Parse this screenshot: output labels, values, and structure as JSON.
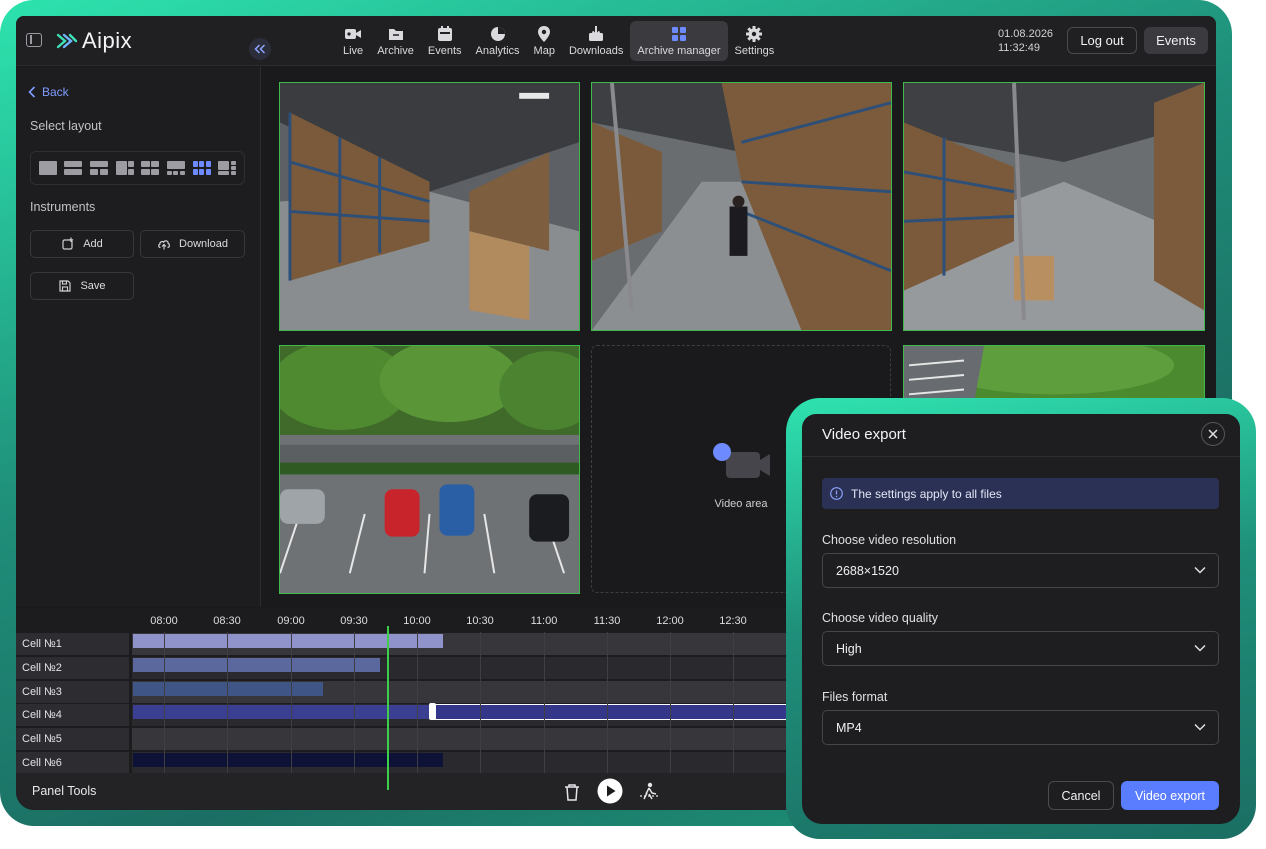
{
  "app": {
    "logo_text": "Aipix",
    "nav": [
      {
        "label": "Live",
        "icon": "camera-icon"
      },
      {
        "label": "Archive",
        "icon": "folder-icon"
      },
      {
        "label": "Events",
        "icon": "calendar-icon"
      },
      {
        "label": "Analytics",
        "icon": "pie-chart-icon"
      },
      {
        "label": "Map",
        "icon": "map-pin-icon"
      },
      {
        "label": "Downloads",
        "icon": "download-tray-icon"
      },
      {
        "label": "Archive manager",
        "icon": "grid-apps-icon",
        "active": true
      },
      {
        "label": "Settings",
        "icon": "gear-icon"
      }
    ],
    "date": "01.08.2026",
    "time": "11:32:49",
    "logout_label": "Log out",
    "events_label": "Events"
  },
  "sidebar": {
    "back_label": "Back",
    "select_layout_title": "Select layout",
    "active_layout_index": 6,
    "instruments_title": "Instruments",
    "add_label": "Add",
    "download_label": "Download",
    "save_label": "Save"
  },
  "grid": {
    "video_area_label": "Video area"
  },
  "timeline": {
    "ticks": [
      "08:00",
      "08:30",
      "09:00",
      "09:30",
      "10:00",
      "10:30",
      "11:00",
      "11:30",
      "12:00",
      "12:30"
    ],
    "rows": [
      "Cell №1",
      "Cell №2",
      "Cell №3",
      "Cell №4",
      "Cell №5",
      "Cell №6"
    ],
    "colors": {
      "row1": "#8f93c9",
      "row2": "#5b689e",
      "row3": "#3f5585",
      "row4": "#3b3f92",
      "row4_selection": "#34368a",
      "row6": "#0e1236",
      "playhead": "#3ecf4a"
    }
  },
  "panel_tools": {
    "label": "Panel Tools"
  },
  "modal": {
    "title": "Video export",
    "info_text": "The settings apply to all files",
    "resolution_label": "Choose video resolution",
    "resolution_value": "2688×1520",
    "quality_label": "Choose video quality",
    "quality_value": "High",
    "format_label": "Files format",
    "format_value": "MP4",
    "cancel_label": "Cancel",
    "export_label": "Video export",
    "accent_color": "#5a7cff"
  }
}
